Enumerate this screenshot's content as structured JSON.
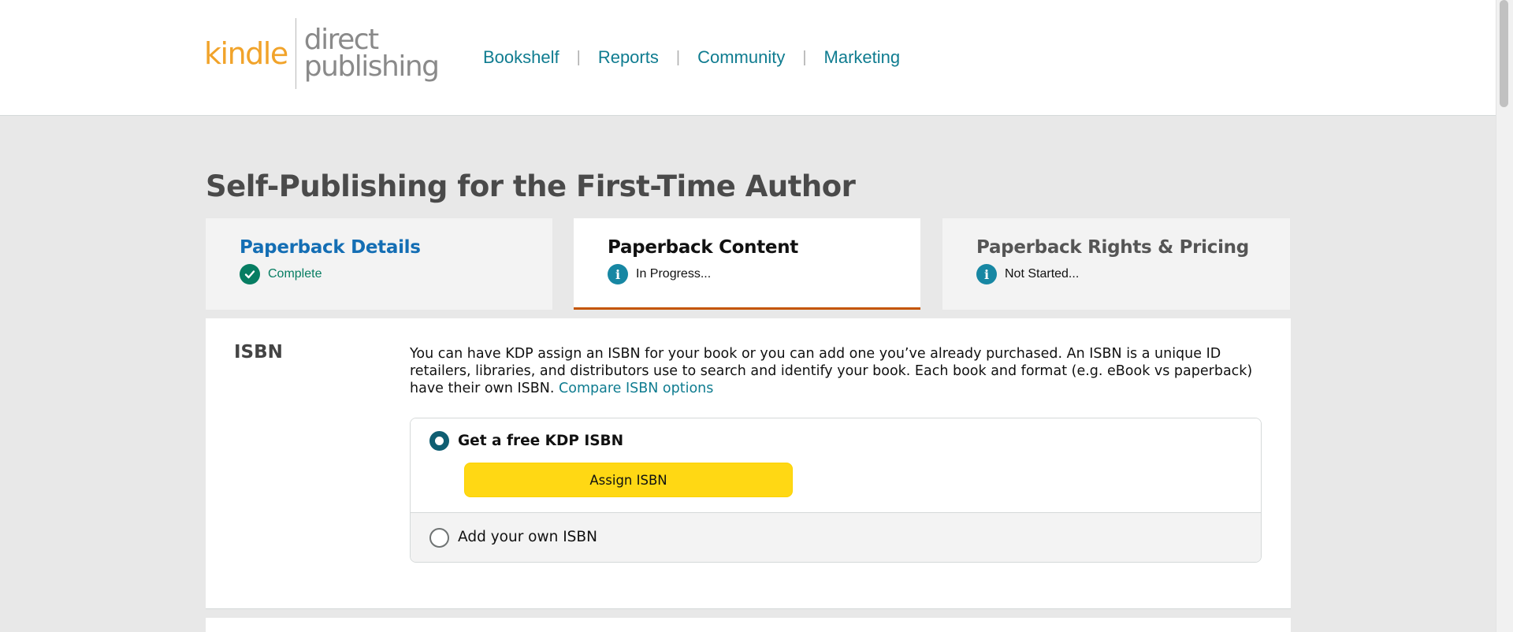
{
  "brand": {
    "logo_kindle": "kindle",
    "logo_line1": "direct",
    "logo_line2": "publishing"
  },
  "nav": {
    "items": [
      "Bookshelf",
      "Reports",
      "Community",
      "Marketing"
    ],
    "separator": "|",
    "link_color": "#0f7c90"
  },
  "book": {
    "title": "Self-Publishing for the First-Time Author"
  },
  "tabs": [
    {
      "title": "Paperback Details",
      "status": "Complete",
      "status_icon": "check-circle-icon",
      "state": "complete"
    },
    {
      "title": "Paperback Content",
      "status": "In Progress...",
      "status_icon": "info-icon",
      "state": "active"
    },
    {
      "title": "Paperback Rights & Pricing",
      "status": "Not Started...",
      "status_icon": "info-icon",
      "state": "not-started"
    }
  ],
  "isbn": {
    "label": "ISBN",
    "description": "You can have KDP assign an ISBN for your book or you can add one you’ve already purchased. An ISBN is a unique ID retailers, libraries, and distributors use to search and identify your book. Each book and format (e.g. eBook vs paperback) have their own ISBN.",
    "compare_link": "Compare ISBN options",
    "options": [
      {
        "label": "Get a free KDP ISBN",
        "selected": true
      },
      {
        "label": "Add your own ISBN",
        "selected": false
      }
    ],
    "assign_button": "Assign ISBN"
  },
  "colors": {
    "accent_button": "#ffd814",
    "active_tab_underline": "#c45500",
    "complete_green": "#067d62",
    "info_teal": "#1787a3"
  }
}
